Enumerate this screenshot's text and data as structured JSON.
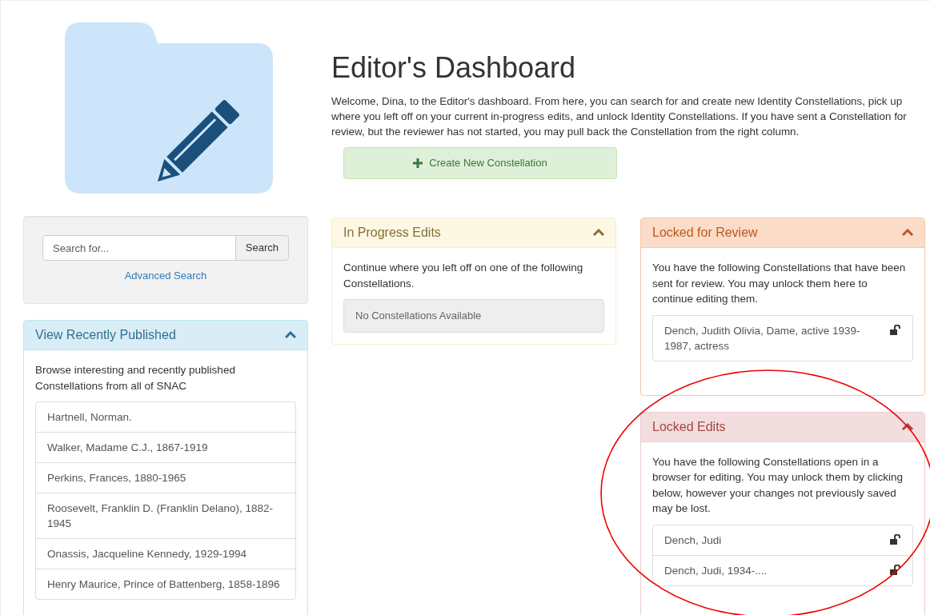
{
  "header": {
    "title": "Editor's Dashboard",
    "intro": "Welcome, Dina, to the Editor's dashboard. From here, you can search for and create new Identity Constellations, pick up where you left off on your current in-progress edits, and unlock Identity Constellations. If you have sent a Constellation for review, but the reviewer has not started, you may pull back the Constellation from the right column.",
    "create_button": "Create New Constellation"
  },
  "left_column": {
    "search": {
      "placeholder": "Search for...",
      "button": "Search",
      "advanced_link": "Advanced Search"
    },
    "panels": [
      {
        "kind": "info",
        "title": "View Recently Published",
        "expanded": true,
        "description": "Browse interesting and recently published Constellations from all of SNAC",
        "items": [
          {
            "label": "Hartnell, Norman.",
            "locked": false
          },
          {
            "label": "Walker, Madame C.J., 1867-1919",
            "locked": false
          },
          {
            "label": "Perkins, Frances, 1880-1965",
            "locked": false
          },
          {
            "label": "Roosevelt, Franklin D. (Franklin Delano), 1882-1945",
            "locked": false
          },
          {
            "label": "Onassis, Jacqueline Kennedy, 1929-1994",
            "locked": false
          },
          {
            "label": "Henry Maurice, Prince of Battenberg, 1858-1896",
            "locked": false
          }
        ]
      }
    ]
  },
  "middle_column": {
    "panels": [
      {
        "kind": "warning",
        "title": "In Progress Edits",
        "expanded": true,
        "description": "Continue where you left off on one of the following Constellations.",
        "empty_text": "No Constellations Available"
      }
    ]
  },
  "right_column": {
    "panels": [
      {
        "kind": "review",
        "title": "Locked for Review",
        "expanded": true,
        "description": "You have the following Constellations that have been sent for review. You may unlock them here to continue editing them.",
        "items": [
          {
            "label": "Dench, Judith Olivia, Dame, active 1939-1987, actress",
            "locked": true
          }
        ]
      },
      {
        "kind": "danger",
        "title": "Locked Edits",
        "expanded": true,
        "description": "You have the following Constellations open in a browser for editing. You may unlock them by clicking below, however your changes not previously saved may be lost.",
        "items": [
          {
            "label": "Dench, Judi",
            "locked": true
          },
          {
            "label": "Dench, Judi, 1934-....",
            "locked": true
          }
        ]
      }
    ]
  }
}
